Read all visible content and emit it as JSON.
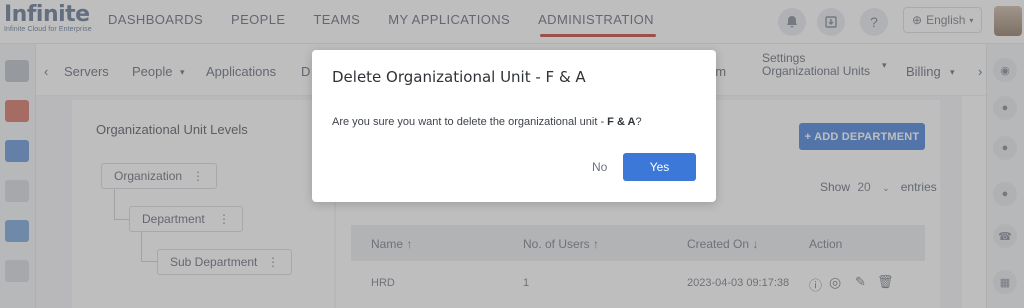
{
  "header": {
    "logo_text": "Infinite",
    "logo_tagline": "Infinite Cloud for Enterprise",
    "nav": [
      "DASHBOARDS",
      "PEOPLE",
      "TEAMS",
      "MY APPLICATIONS",
      "ADMINISTRATION"
    ],
    "active_nav": "ADMINISTRATION",
    "icons": [
      "bell-icon",
      "download-icon",
      "help-icon"
    ],
    "language": "English"
  },
  "subnav": {
    "items": [
      "Servers",
      "People",
      "Applications",
      "D",
      "em"
    ],
    "settings_label": "Settings",
    "settings_value": "Organizational Units",
    "billing": "Billing"
  },
  "page": {
    "ou_levels_title": "Organizational Unit Levels",
    "tree": [
      "Organization",
      "Department",
      "Sub Department"
    ],
    "add_department": "+ ADD DEPARTMENT",
    "show_label": "Show",
    "show_value": "20",
    "entries_label": "entries",
    "table": {
      "columns": [
        "Name ↑",
        "No. of Users ↑",
        "Created On ↓",
        "Action"
      ],
      "rows": [
        {
          "name": "HRD",
          "users": "1",
          "created": "2023-04-03 09:17:38"
        }
      ]
    }
  },
  "modal": {
    "title": "Delete Organizational Unit - F & A",
    "body_prefix": "Are you sure you want to delete the organizational unit - ",
    "body_unit": "F & A",
    "body_suffix": "?",
    "no_label": "No",
    "yes_label": "Yes"
  },
  "colors": {
    "primary": "#3c78d8",
    "active_underline": "#c0392b"
  }
}
